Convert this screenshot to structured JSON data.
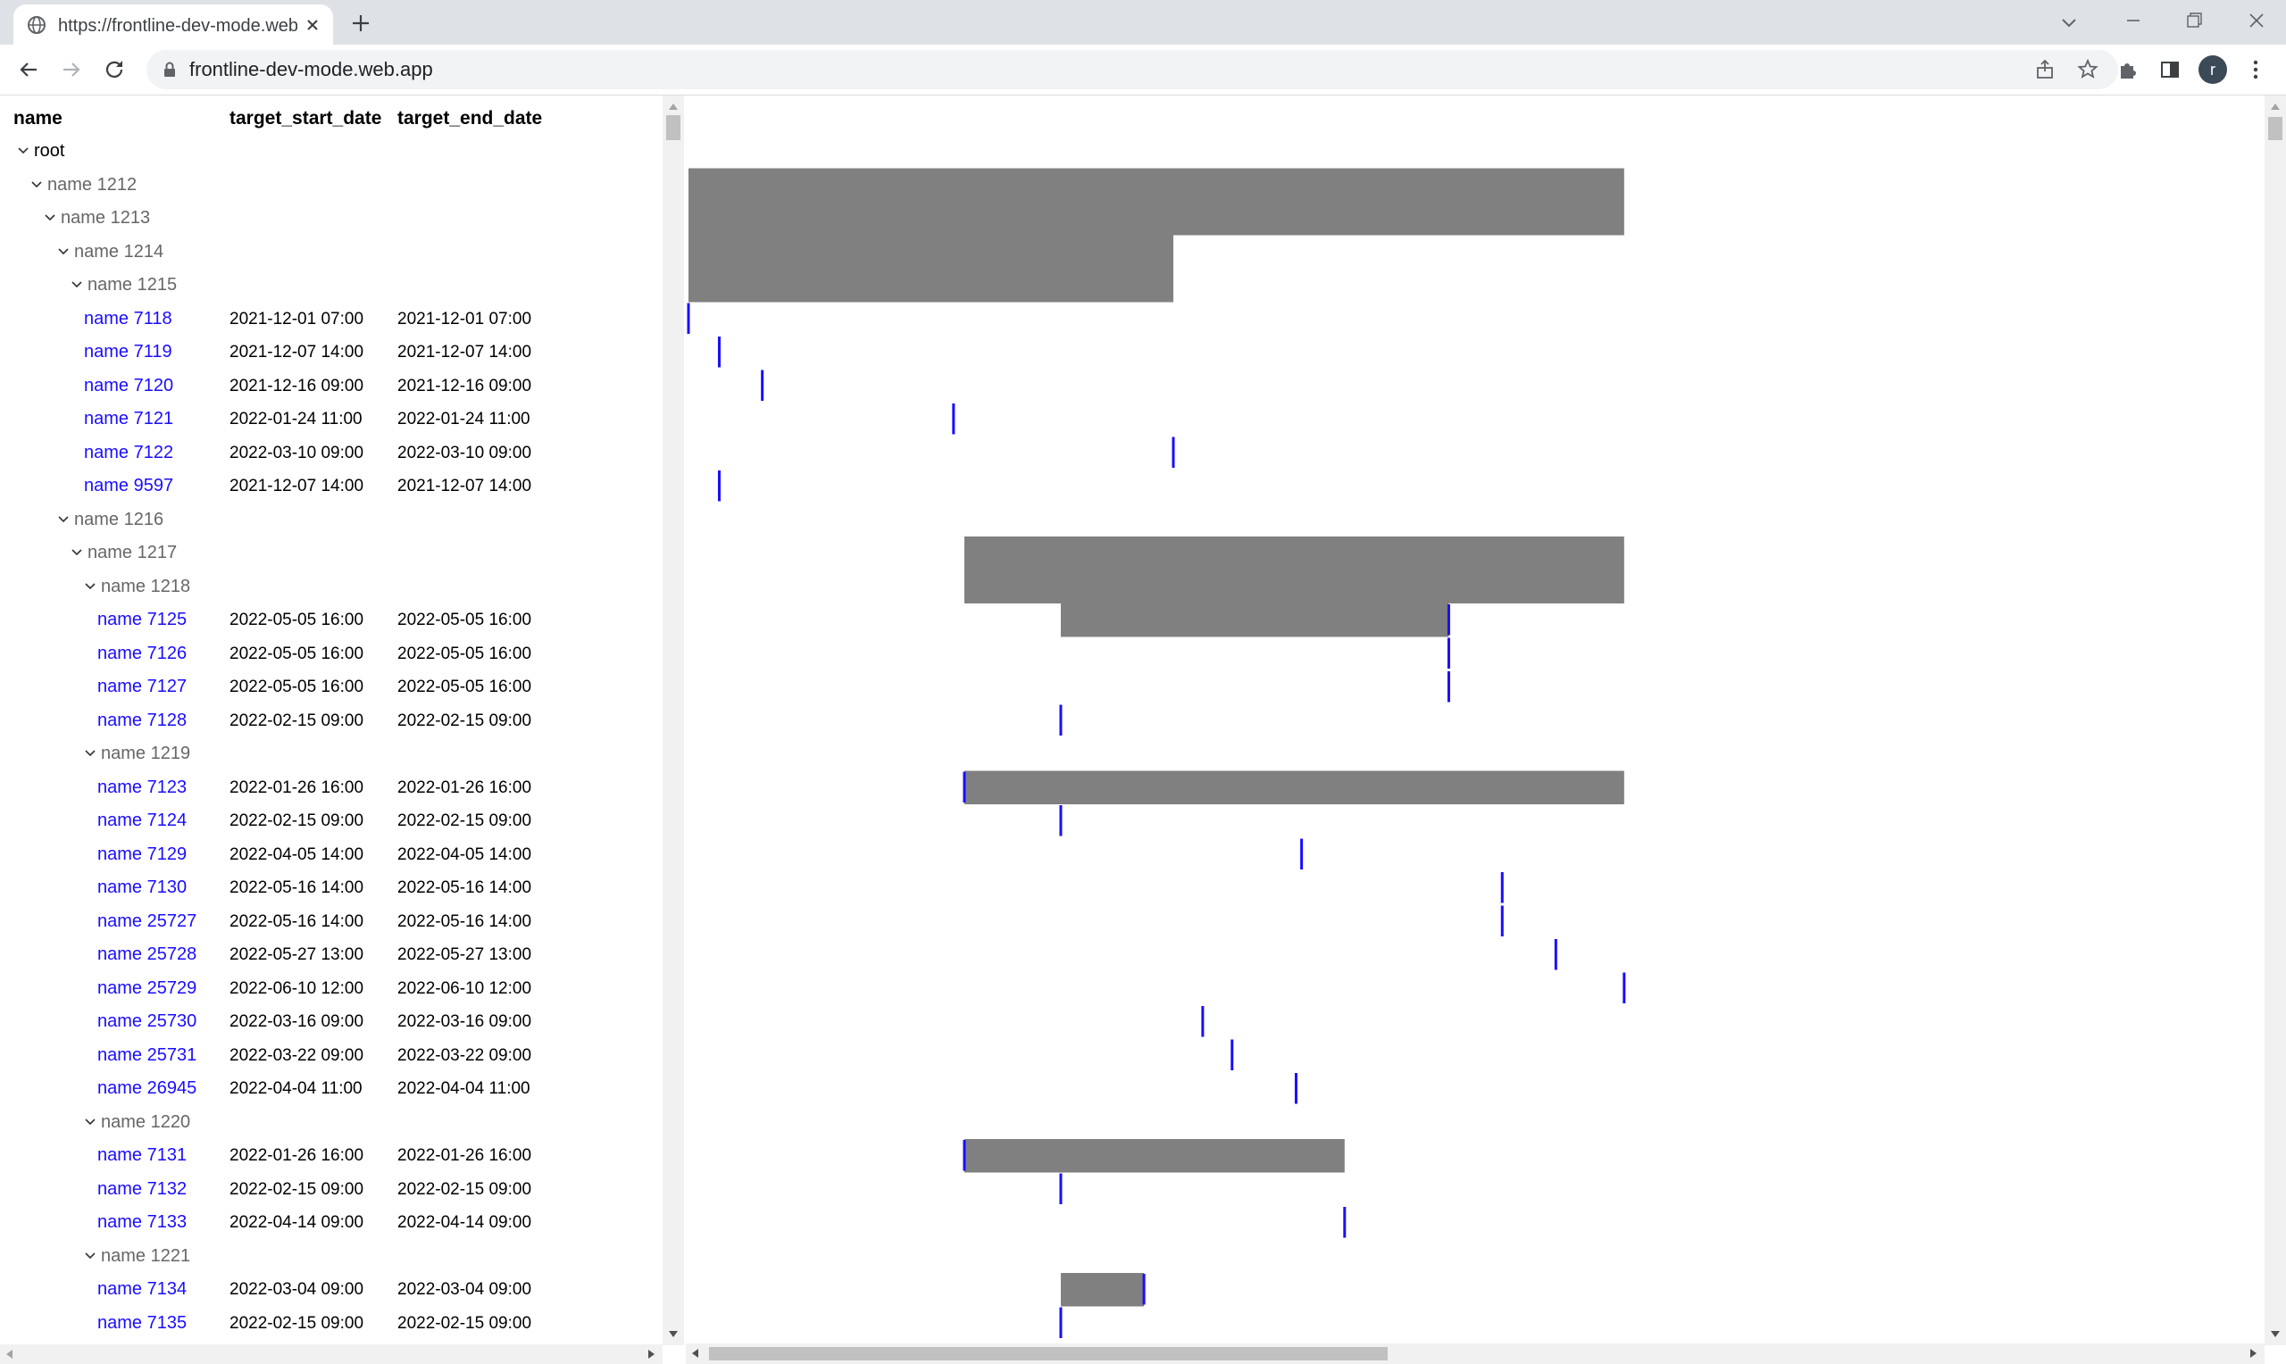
{
  "browser": {
    "tab_title": "https://frontline-dev-mode.web.app",
    "url": "frontline-dev-mode.web.app",
    "avatar_letter": "r"
  },
  "colors": {
    "group_bar": "#808080",
    "milestone": "#1a0dff",
    "leaf_text": "#1a0dff",
    "group_text": "#666666"
  },
  "table": {
    "headers": {
      "name": "name",
      "start": "target_start_date",
      "end": "target_end_date"
    },
    "rows": [
      {
        "name": "root",
        "type": "root",
        "level": 0,
        "start": "",
        "end": ""
      },
      {
        "name": "name 1212",
        "type": "group",
        "level": 1,
        "start": "",
        "end": ""
      },
      {
        "name": "name 1213",
        "type": "group",
        "level": 2,
        "start": "",
        "end": ""
      },
      {
        "name": "name 1214",
        "type": "group",
        "level": 3,
        "start": "",
        "end": ""
      },
      {
        "name": "name 1215",
        "type": "group",
        "level": 4,
        "start": "",
        "end": ""
      },
      {
        "name": "name 7118",
        "type": "leaf",
        "level": 5,
        "start": "2021-12-01 07:00",
        "end": "2021-12-01 07:00"
      },
      {
        "name": "name 7119",
        "type": "leaf",
        "level": 5,
        "start": "2021-12-07 14:00",
        "end": "2021-12-07 14:00"
      },
      {
        "name": "name 7120",
        "type": "leaf",
        "level": 5,
        "start": "2021-12-16 09:00",
        "end": "2021-12-16 09:00"
      },
      {
        "name": "name 7121",
        "type": "leaf",
        "level": 5,
        "start": "2022-01-24 11:00",
        "end": "2022-01-24 11:00"
      },
      {
        "name": "name 7122",
        "type": "leaf",
        "level": 5,
        "start": "2022-03-10 09:00",
        "end": "2022-03-10 09:00"
      },
      {
        "name": "name 9597",
        "type": "leaf",
        "level": 5,
        "start": "2021-12-07 14:00",
        "end": "2021-12-07 14:00"
      },
      {
        "name": "name 1216",
        "type": "group",
        "level": 3,
        "start": "",
        "end": ""
      },
      {
        "name": "name 1217",
        "type": "group",
        "level": 4,
        "start": "",
        "end": ""
      },
      {
        "name": "name 1218",
        "type": "group",
        "level": 5,
        "start": "",
        "end": ""
      },
      {
        "name": "name 7125",
        "type": "leaf",
        "level": 6,
        "start": "2022-05-05 16:00",
        "end": "2022-05-05 16:00"
      },
      {
        "name": "name 7126",
        "type": "leaf",
        "level": 6,
        "start": "2022-05-05 16:00",
        "end": "2022-05-05 16:00"
      },
      {
        "name": "name 7127",
        "type": "leaf",
        "level": 6,
        "start": "2022-05-05 16:00",
        "end": "2022-05-05 16:00"
      },
      {
        "name": "name 7128",
        "type": "leaf",
        "level": 6,
        "start": "2022-02-15 09:00",
        "end": "2022-02-15 09:00"
      },
      {
        "name": "name 1219",
        "type": "group",
        "level": 5,
        "start": "",
        "end": ""
      },
      {
        "name": "name 7123",
        "type": "leaf",
        "level": 6,
        "start": "2022-01-26 16:00",
        "end": "2022-01-26 16:00"
      },
      {
        "name": "name 7124",
        "type": "leaf",
        "level": 6,
        "start": "2022-02-15 09:00",
        "end": "2022-02-15 09:00"
      },
      {
        "name": "name 7129",
        "type": "leaf",
        "level": 6,
        "start": "2022-04-05 14:00",
        "end": "2022-04-05 14:00"
      },
      {
        "name": "name 7130",
        "type": "leaf",
        "level": 6,
        "start": "2022-05-16 14:00",
        "end": "2022-05-16 14:00"
      },
      {
        "name": "name 25727",
        "type": "leaf",
        "level": 6,
        "start": "2022-05-16 14:00",
        "end": "2022-05-16 14:00"
      },
      {
        "name": "name 25728",
        "type": "leaf",
        "level": 6,
        "start": "2022-05-27 13:00",
        "end": "2022-05-27 13:00"
      },
      {
        "name": "name 25729",
        "type": "leaf",
        "level": 6,
        "start": "2022-06-10 12:00",
        "end": "2022-06-10 12:00"
      },
      {
        "name": "name 25730",
        "type": "leaf",
        "level": 6,
        "start": "2022-03-16 09:00",
        "end": "2022-03-16 09:00"
      },
      {
        "name": "name 25731",
        "type": "leaf",
        "level": 6,
        "start": "2022-03-22 09:00",
        "end": "2022-03-22 09:00"
      },
      {
        "name": "name 26945",
        "type": "leaf",
        "level": 6,
        "start": "2022-04-04 11:00",
        "end": "2022-04-04 11:00"
      },
      {
        "name": "name 1220",
        "type": "group",
        "level": 5,
        "start": "",
        "end": ""
      },
      {
        "name": "name 7131",
        "type": "leaf",
        "level": 6,
        "start": "2022-01-26 16:00",
        "end": "2022-01-26 16:00"
      },
      {
        "name": "name 7132",
        "type": "leaf",
        "level": 6,
        "start": "2022-02-15 09:00",
        "end": "2022-02-15 09:00"
      },
      {
        "name": "name 7133",
        "type": "leaf",
        "level": 6,
        "start": "2022-04-14 09:00",
        "end": "2022-04-14 09:00"
      },
      {
        "name": "name 1221",
        "type": "group",
        "level": 5,
        "start": "",
        "end": ""
      },
      {
        "name": "name 7134",
        "type": "leaf",
        "level": 6,
        "start": "2022-03-04 09:00",
        "end": "2022-03-04 09:00"
      },
      {
        "name": "name 7135",
        "type": "leaf",
        "level": 6,
        "start": "2022-02-15 09:00",
        "end": "2022-02-15 09:00"
      }
    ]
  },
  "gantt": {
    "view_start": "2021-12-01 07:00",
    "group_spans": [
      {
        "row": 1,
        "start": "2021-12-01 07:00",
        "end": "2022-06-10 12:00"
      },
      {
        "row": 2,
        "start": "2021-12-01 07:00",
        "end": "2022-06-10 12:00"
      },
      {
        "row": 3,
        "start": "2021-12-01 07:00",
        "end": "2022-03-10 09:00"
      },
      {
        "row": 4,
        "start": "2021-12-01 07:00",
        "end": "2022-03-10 09:00"
      },
      {
        "row": 12,
        "start": "2022-01-26 16:00",
        "end": "2022-06-10 12:00"
      },
      {
        "row": 13,
        "start": "2022-01-26 16:00",
        "end": "2022-06-10 12:00"
      },
      {
        "row": 14,
        "start": "2022-02-15 09:00",
        "end": "2022-05-05 16:00"
      },
      {
        "row": 19,
        "start": "2022-01-26 16:00",
        "end": "2022-06-10 12:00"
      },
      {
        "row": 30,
        "start": "2022-01-26 16:00",
        "end": "2022-04-14 09:00"
      },
      {
        "row": 34,
        "start": "2022-02-15 09:00",
        "end": "2022-03-04 09:00"
      }
    ]
  }
}
